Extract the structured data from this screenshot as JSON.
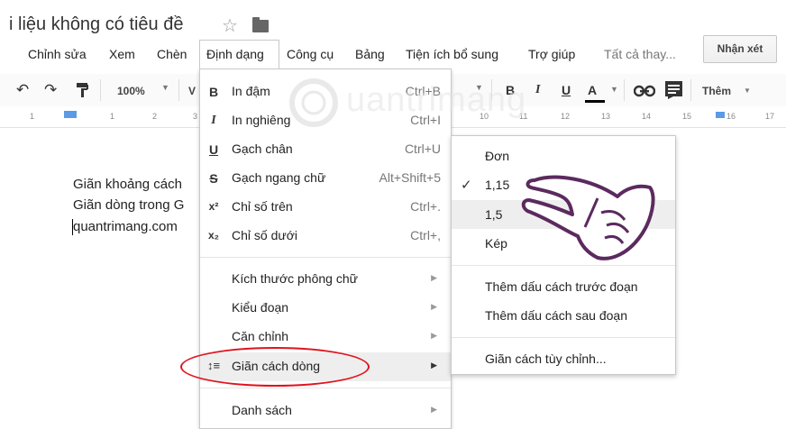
{
  "title": {
    "doc_title": "i liệu không có tiêu đề"
  },
  "menu": {
    "items": [
      "Chỉnh sửa",
      "Xem",
      "Chèn",
      "Định dạng",
      "Công cụ",
      "Bảng",
      "Tiện ích bổ sung",
      "Trợ giúp"
    ],
    "all_changes": "Tất cả thay...",
    "comment_label": "Nhận xét"
  },
  "toolbar": {
    "zoom": "100%",
    "truncated_label": "V",
    "more_label": "Thêm"
  },
  "ruler": {
    "numbers": [
      "1",
      "1",
      "2",
      "3",
      "10",
      "11",
      "12",
      "13",
      "14",
      "15",
      "16",
      "17"
    ]
  },
  "document": {
    "lines": [
      "Giãn khoảng cách",
      "Giãn dòng trong G",
      "quantrimang.com"
    ]
  },
  "format_menu": {
    "items": [
      {
        "icon": "B",
        "label": "In đậm",
        "shortcut": "Ctrl+B"
      },
      {
        "icon": "I",
        "label": "In nghiêng",
        "shortcut": "Ctrl+I"
      },
      {
        "icon": "U",
        "label": "Gạch chân",
        "shortcut": "Ctrl+U"
      },
      {
        "icon": "S",
        "label": "Gạch ngang chữ",
        "shortcut": "Alt+Shift+5"
      },
      {
        "icon": "x²",
        "label": "Chỉ số trên",
        "shortcut": "Ctrl+."
      },
      {
        "icon": "x₂",
        "label": "Chỉ số dưới",
        "shortcut": "Ctrl+,"
      },
      {
        "label": "Kích thước phông chữ"
      },
      {
        "label": "Kiểu đoạn"
      },
      {
        "label": "Căn chỉnh"
      },
      {
        "label": "Giãn cách dòng"
      },
      {
        "label": "Danh sách"
      }
    ]
  },
  "spacing_submenu": {
    "options": [
      "Đơn",
      "1,15",
      "1,5",
      "Kép"
    ],
    "checked": "1,15",
    "actions": [
      "Thêm dấu cách trước đoạn",
      "Thêm dấu cách sau đoạn"
    ],
    "custom": "Giãn cách tùy chỉnh..."
  },
  "colors": {
    "highlight": "#e0141e",
    "hand_outline": "#5b2a5e",
    "hover": "#eeeeee"
  }
}
